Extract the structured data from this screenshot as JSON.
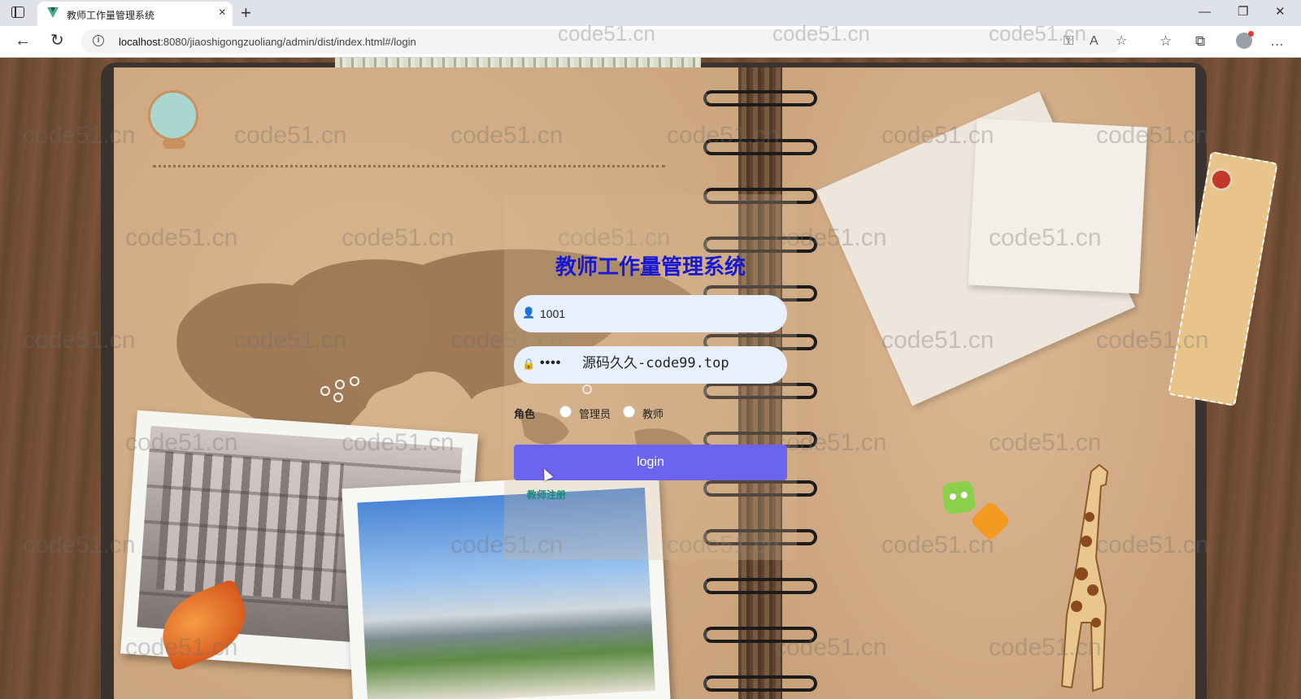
{
  "browser": {
    "tab_title": "教师工作量管理系统",
    "tab_close": "×",
    "new_tab": "+",
    "window_controls": {
      "minimize": "—",
      "restore": "❐",
      "close": "✕"
    },
    "url_host": "localhost",
    "url_rest": ":8080/jiaoshigongzuoliang/admin/dist/index.html#/login",
    "icons": [
      "back-arrow-icon",
      "reload-icon",
      "info-icon",
      "key-icon",
      "read-aloud-icon",
      "add-favorite-icon",
      "favorites-icon",
      "collections-icon",
      "profile-icon",
      "more-icon"
    ]
  },
  "watermark_text": "code51.cn",
  "login": {
    "title": "教师工作量管理系统",
    "username_value": "1001",
    "password_mask": "••••",
    "password_overlay": "源码久久-code99.top",
    "role_label": "角色",
    "roles": [
      "管理员",
      "教师"
    ],
    "login_button": "login",
    "register_link": "教师注册"
  },
  "colors": {
    "title": "#1717d6",
    "button": "#6c63ee",
    "input_bg": "#e8f0fe",
    "register_link": "#138a7c"
  }
}
